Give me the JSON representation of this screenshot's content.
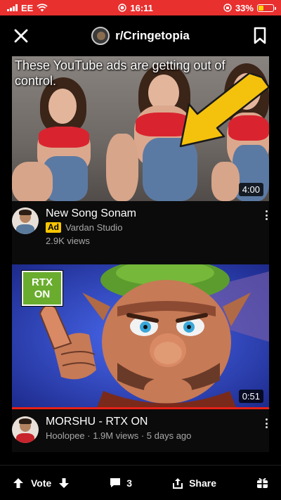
{
  "status_bar": {
    "carrier": "EE",
    "time": "16:11",
    "battery_percent": "33%",
    "battery_level": 0.33,
    "background_color": "#e8302f"
  },
  "header": {
    "subreddit": "r/Cringetopia",
    "close_icon": "close-icon",
    "bookmark_icon": "bookmark-icon"
  },
  "videos": [
    {
      "overlay_text": "These YouTube ads are getting out of control.",
      "duration": "4:00",
      "title": "New Song Sonam",
      "ad_label": "Ad",
      "channel": "Vardan Studio",
      "views": "2.9K views"
    },
    {
      "badge_line1": "RTX",
      "badge_line2": "ON",
      "duration": "0:51",
      "title": "MORSHU - RTX ON",
      "info": "Hoolopee · 1.9M views · 5 days ago"
    }
  ],
  "bottom_bar": {
    "vote_label": "Vote",
    "comment_count": "3",
    "share_label": "Share"
  },
  "colors": {
    "ad_badge": "#f7c600",
    "rtx_badge": "#6aad2e",
    "arrow": "#f4c20d",
    "progress": "#e62117"
  }
}
